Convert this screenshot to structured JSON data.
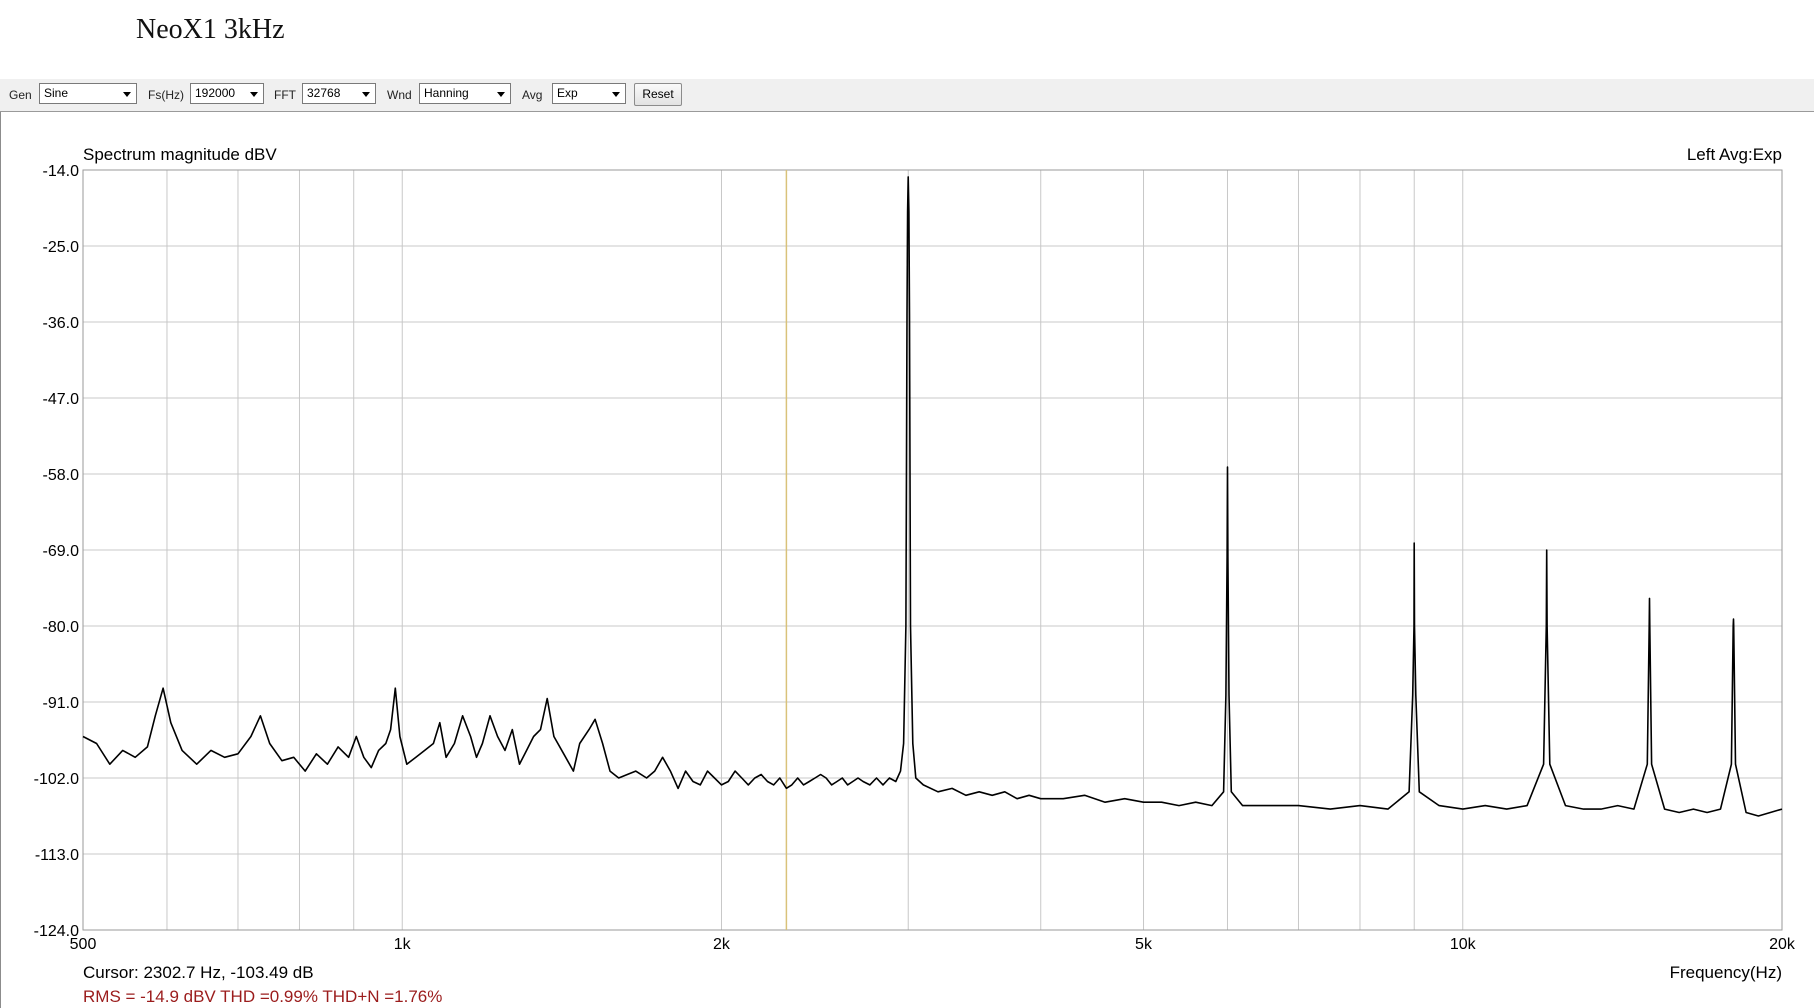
{
  "app": {
    "title": "NeoX1 3kHz"
  },
  "toolbar": {
    "gen_label": "Gen",
    "gen_value": "Sine",
    "fs_label": "Fs(Hz)",
    "fs_value": "192000",
    "fft_label": "FFT",
    "fft_value": "32768",
    "wnd_label": "Wnd",
    "wnd_value": "Hanning",
    "avg_label": "Avg",
    "avg_value": "Exp",
    "reset_label": "Reset",
    "icons": {
      "dropdown": "chevron-down-icon"
    }
  },
  "cursor": {
    "text": "Cursor:  2302.7 Hz, -103.49 dB",
    "freq": 2302.7
  },
  "stats": {
    "text": "RMS =  -14.9 dBV   THD =0.99%   THD+N =1.76%"
  },
  "colors": {
    "trace": "#000000",
    "cursor_line": "#d9c27a",
    "grid": "#c8c8c8",
    "stats": "#9b1c1c"
  },
  "chart_data": {
    "type": "line",
    "title": "Spectrum magnitude dBV",
    "legend": "Left  Avg:Exp",
    "xlabel": "Frequency(Hz)",
    "x_scale": "log",
    "xlim": [
      500,
      20000
    ],
    "ylim": [
      -124,
      -14
    ],
    "grid": true,
    "x_ticks": [
      {
        "value": 500,
        "label": "500"
      },
      {
        "value": 1000,
        "label": "1k"
      },
      {
        "value": 2000,
        "label": "2k"
      },
      {
        "value": 5000,
        "label": "5k"
      },
      {
        "value": 10000,
        "label": "10k"
      },
      {
        "value": 20000,
        "label": "20k"
      }
    ],
    "y_ticks": [
      {
        "value": -14,
        "label": "-14.0"
      },
      {
        "value": -25,
        "label": "-25.0"
      },
      {
        "value": -36,
        "label": "-36.0"
      },
      {
        "value": -47,
        "label": "-47.0"
      },
      {
        "value": -58,
        "label": "-58.0"
      },
      {
        "value": -69,
        "label": "-69.0"
      },
      {
        "value": -80,
        "label": "-80.0"
      },
      {
        "value": -91,
        "label": "-91.0"
      },
      {
        "value": -102,
        "label": "-102.0"
      },
      {
        "value": -113,
        "label": "-113.0"
      },
      {
        "value": -124,
        "label": "-124.0"
      }
    ],
    "series": [
      {
        "values": [
          [
            500,
            -96
          ],
          [
            515,
            -97
          ],
          [
            530,
            -100
          ],
          [
            545,
            -98
          ],
          [
            560,
            -99
          ],
          [
            575,
            -97.5
          ],
          [
            585,
            -93
          ],
          [
            595,
            -89
          ],
          [
            605,
            -94
          ],
          [
            620,
            -98
          ],
          [
            640,
            -100
          ],
          [
            660,
            -98
          ],
          [
            680,
            -99
          ],
          [
            700,
            -98.5
          ],
          [
            720,
            -96
          ],
          [
            735,
            -93
          ],
          [
            750,
            -97
          ],
          [
            770,
            -99.5
          ],
          [
            790,
            -99
          ],
          [
            810,
            -101
          ],
          [
            830,
            -98.5
          ],
          [
            850,
            -100
          ],
          [
            870,
            -97.5
          ],
          [
            890,
            -99
          ],
          [
            905,
            -96
          ],
          [
            920,
            -99
          ],
          [
            935,
            -100.5
          ],
          [
            950,
            -98
          ],
          [
            965,
            -97
          ],
          [
            975,
            -95
          ],
          [
            985,
            -89
          ],
          [
            995,
            -96
          ],
          [
            1010,
            -100
          ],
          [
            1030,
            -99
          ],
          [
            1050,
            -98
          ],
          [
            1070,
            -97
          ],
          [
            1085,
            -94
          ],
          [
            1100,
            -99
          ],
          [
            1120,
            -97
          ],
          [
            1140,
            -93
          ],
          [
            1160,
            -96
          ],
          [
            1175,
            -99
          ],
          [
            1190,
            -97
          ],
          [
            1210,
            -93
          ],
          [
            1230,
            -96
          ],
          [
            1250,
            -98
          ],
          [
            1270,
            -95
          ],
          [
            1290,
            -100
          ],
          [
            1310,
            -98
          ],
          [
            1330,
            -96
          ],
          [
            1350,
            -95
          ],
          [
            1370,
            -90.5
          ],
          [
            1390,
            -96
          ],
          [
            1420,
            -98.5
          ],
          [
            1450,
            -101
          ],
          [
            1470,
            -97
          ],
          [
            1500,
            -95
          ],
          [
            1520,
            -93.5
          ],
          [
            1545,
            -97
          ],
          [
            1570,
            -101
          ],
          [
            1600,
            -102
          ],
          [
            1630,
            -101.5
          ],
          [
            1660,
            -101
          ],
          [
            1700,
            -102
          ],
          [
            1730,
            -101
          ],
          [
            1760,
            -99
          ],
          [
            1790,
            -101
          ],
          [
            1820,
            -103.5
          ],
          [
            1850,
            -101
          ],
          [
            1880,
            -102.5
          ],
          [
            1910,
            -103
          ],
          [
            1940,
            -101
          ],
          [
            1970,
            -102
          ],
          [
            2000,
            -103
          ],
          [
            2030,
            -102.5
          ],
          [
            2060,
            -101
          ],
          [
            2090,
            -102
          ],
          [
            2120,
            -103
          ],
          [
            2150,
            -102
          ],
          [
            2180,
            -101.5
          ],
          [
            2210,
            -102.5
          ],
          [
            2240,
            -103
          ],
          [
            2270,
            -102
          ],
          [
            2302.7,
            -103.49
          ],
          [
            2330,
            -103
          ],
          [
            2360,
            -102
          ],
          [
            2390,
            -103
          ],
          [
            2420,
            -102.5
          ],
          [
            2450,
            -102
          ],
          [
            2480,
            -101.5
          ],
          [
            2510,
            -102
          ],
          [
            2540,
            -103
          ],
          [
            2570,
            -102.5
          ],
          [
            2600,
            -102
          ],
          [
            2630,
            -103
          ],
          [
            2660,
            -102.5
          ],
          [
            2690,
            -102
          ],
          [
            2720,
            -102.5
          ],
          [
            2760,
            -103
          ],
          [
            2800,
            -102
          ],
          [
            2840,
            -103
          ],
          [
            2880,
            -102
          ],
          [
            2920,
            -102.5
          ],
          [
            2950,
            -101
          ],
          [
            2970,
            -97
          ],
          [
            2985,
            -80
          ],
          [
            2992,
            -35
          ],
          [
            2996,
            -20
          ],
          [
            3000,
            -15
          ],
          [
            3004,
            -20
          ],
          [
            3008,
            -35
          ],
          [
            3015,
            -80
          ],
          [
            3030,
            -97
          ],
          [
            3050,
            -102
          ],
          [
            3100,
            -103
          ],
          [
            3200,
            -104
          ],
          [
            3300,
            -103.5
          ],
          [
            3400,
            -104.5
          ],
          [
            3500,
            -104
          ],
          [
            3600,
            -104.5
          ],
          [
            3700,
            -104
          ],
          [
            3800,
            -105
          ],
          [
            3900,
            -104.5
          ],
          [
            4000,
            -105
          ],
          [
            4200,
            -105
          ],
          [
            4400,
            -104.5
          ],
          [
            4600,
            -105.5
          ],
          [
            4800,
            -105
          ],
          [
            5000,
            -105.5
          ],
          [
            5200,
            -105.5
          ],
          [
            5400,
            -106
          ],
          [
            5600,
            -105.5
          ],
          [
            5800,
            -106
          ],
          [
            5950,
            -104
          ],
          [
            5980,
            -90
          ],
          [
            5995,
            -70
          ],
          [
            6000,
            -57
          ],
          [
            6005,
            -70
          ],
          [
            6020,
            -90
          ],
          [
            6050,
            -104
          ],
          [
            6200,
            -106
          ],
          [
            6500,
            -106
          ],
          [
            7000,
            -106
          ],
          [
            7500,
            -106.5
          ],
          [
            8000,
            -106
          ],
          [
            8500,
            -106.5
          ],
          [
            8900,
            -104
          ],
          [
            8970,
            -90
          ],
          [
            8995,
            -80
          ],
          [
            9000,
            -68
          ],
          [
            9005,
            -80
          ],
          [
            9030,
            -90
          ],
          [
            9100,
            -104
          ],
          [
            9500,
            -106
          ],
          [
            10000,
            -106.5
          ],
          [
            10500,
            -106
          ],
          [
            11000,
            -106.5
          ],
          [
            11500,
            -106
          ],
          [
            11920,
            -100
          ],
          [
            11990,
            -80
          ],
          [
            12000,
            -69
          ],
          [
            12010,
            -80
          ],
          [
            12080,
            -100
          ],
          [
            12500,
            -106
          ],
          [
            13000,
            -106.5
          ],
          [
            13500,
            -106.5
          ],
          [
            14000,
            -106
          ],
          [
            14500,
            -106.5
          ],
          [
            14930,
            -100
          ],
          [
            14990,
            -80
          ],
          [
            15000,
            -76
          ],
          [
            15010,
            -80
          ],
          [
            15070,
            -100
          ],
          [
            15500,
            -106.5
          ],
          [
            16000,
            -107
          ],
          [
            16500,
            -106.5
          ],
          [
            17000,
            -107
          ],
          [
            17500,
            -106.5
          ],
          [
            17920,
            -100
          ],
          [
            17990,
            -80
          ],
          [
            18000,
            -79
          ],
          [
            18010,
            -80
          ],
          [
            18080,
            -100
          ],
          [
            18500,
            -107
          ],
          [
            19000,
            -107.5
          ],
          [
            19500,
            -107
          ],
          [
            20000,
            -106.5
          ]
        ]
      }
    ]
  }
}
